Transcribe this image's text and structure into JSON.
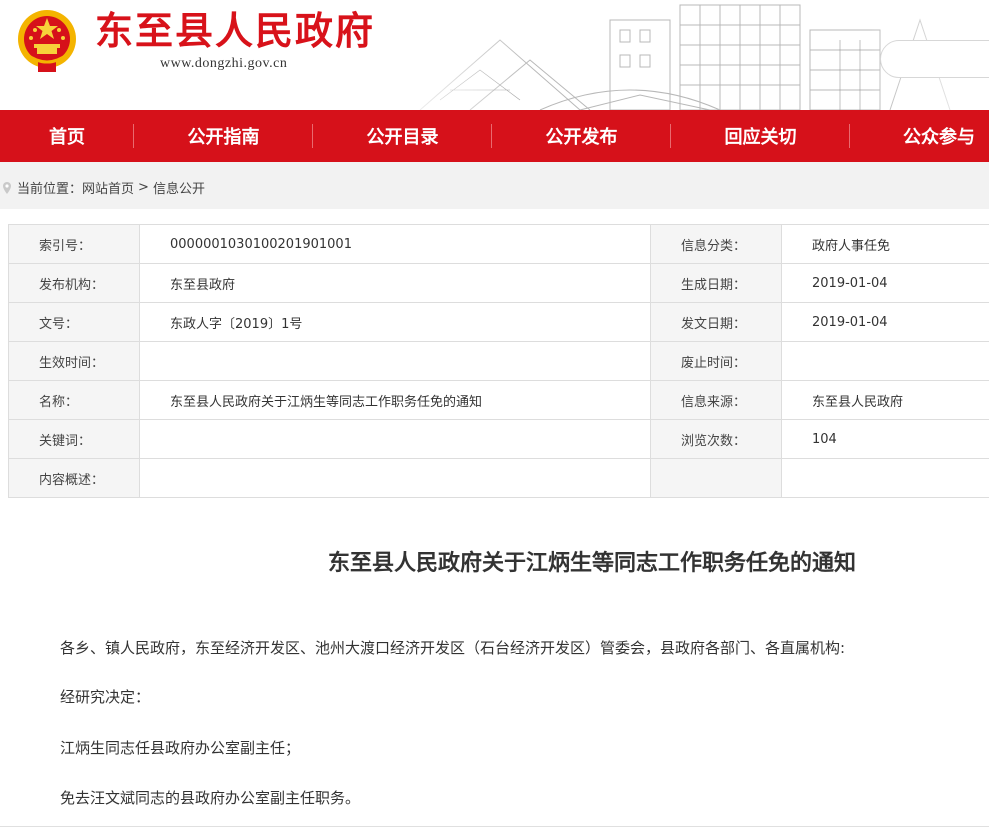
{
  "header": {
    "site_title": "东至县人民政府",
    "site_url": "www.dongzhi.gov.cn",
    "brand_red": "#d6111a"
  },
  "nav": {
    "items": [
      {
        "label": "首页"
      },
      {
        "label": "公开指南"
      },
      {
        "label": "公开目录"
      },
      {
        "label": "公开发布"
      },
      {
        "label": "回应关切"
      },
      {
        "label": "公众参与"
      }
    ]
  },
  "breadcrumb": {
    "prefix": "当前位置：",
    "home": "网站首页",
    "separator": ">",
    "current": "信息公开"
  },
  "info": {
    "rows": [
      {
        "k1": "索引号：",
        "v1": "000000103010020190​1001",
        "k2": "信息分类：",
        "v2": "政府人事任免"
      },
      {
        "k1": "发布机构：",
        "v1": "东至县政府",
        "k2": "生成日期：",
        "v2": "2019-01-04"
      },
      {
        "k1": "文号：",
        "v1": "东政人字〔2019〕1号",
        "k2": "发文日期：",
        "v2": "2019-01-04"
      },
      {
        "k1": "生效时间：",
        "v1": "",
        "k2": "废止时间：",
        "v2": ""
      },
      {
        "k1": "名称：",
        "v1": "东至县人民政府关于江炳生等同志工作职务任免的通知",
        "k2": "信息来源：",
        "v2": "东至县人民政府"
      },
      {
        "k1": "关键词：",
        "v1": "",
        "k2": "浏览次数：",
        "v2": "104"
      },
      {
        "k1": "内容概述：",
        "v1": "",
        "k2": "",
        "v2": ""
      }
    ]
  },
  "article": {
    "title": "东至县人民政府关于江炳生等同志工作职务任免的通知",
    "paragraphs": [
      "各乡、镇人民政府，东至经济开发区、池州大渡口经济开发区（石台经济开发区）管委会，县政府各部门、各直属机构:",
      "经研究决定：",
      "江炳生同志任县政府办公室副主任；",
      "免去汪文斌同志的县政府办公室副主任职务。"
    ]
  }
}
